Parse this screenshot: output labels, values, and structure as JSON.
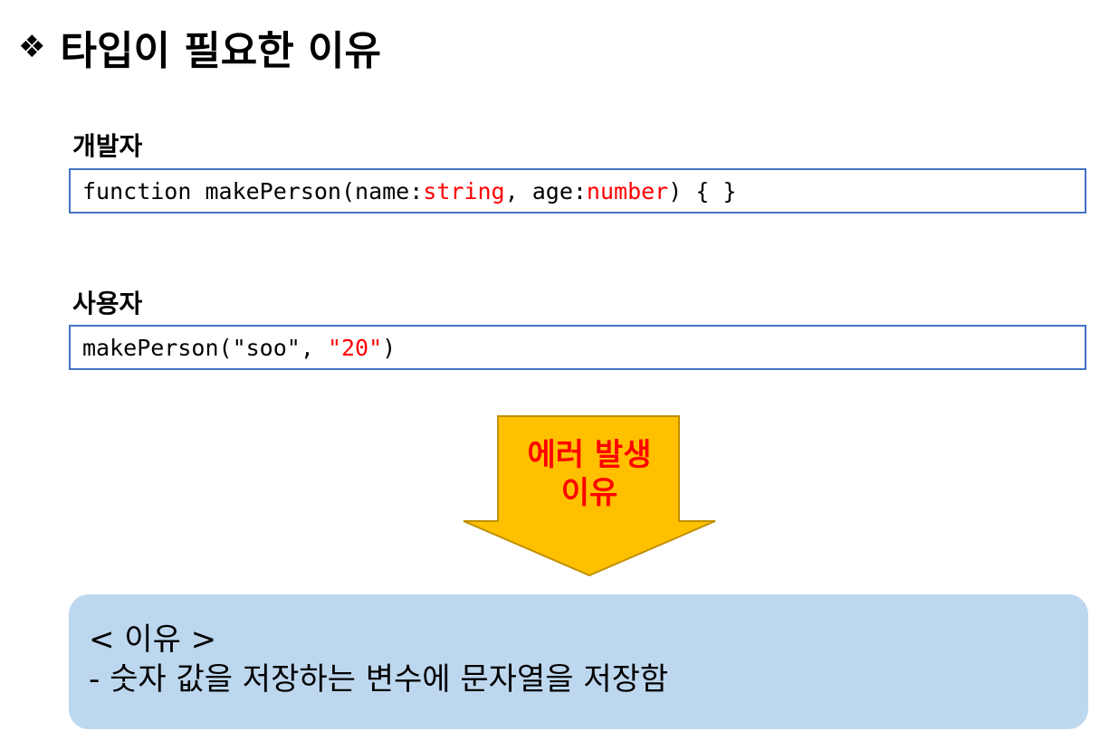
{
  "title": {
    "bullet": "❖",
    "text": "타입이 필요한 이유"
  },
  "developer": {
    "label": "개발자",
    "code": {
      "prefix": "function makePerson(name:",
      "type1": "string",
      "middle": ", age:",
      "type2": "number",
      "suffix": ") { }"
    }
  },
  "user": {
    "label": "사용자",
    "code": {
      "prefix": "makePerson(\"soo\", ",
      "arg": "\"20\"",
      "suffix": ")"
    }
  },
  "arrow": {
    "line1": "에러 발생",
    "line2": "이유",
    "fill_color": "#ffc000",
    "border_color": "#bf9000",
    "text_color": "#ff0000"
  },
  "reason": {
    "heading": "< 이유 >",
    "body": "- 숫자 값을 저장하는 변수에 문자열을 저장함",
    "background_color": "#bdd7ee"
  },
  "colors": {
    "code_border": "#4472c4",
    "highlight": "#ff0000"
  }
}
